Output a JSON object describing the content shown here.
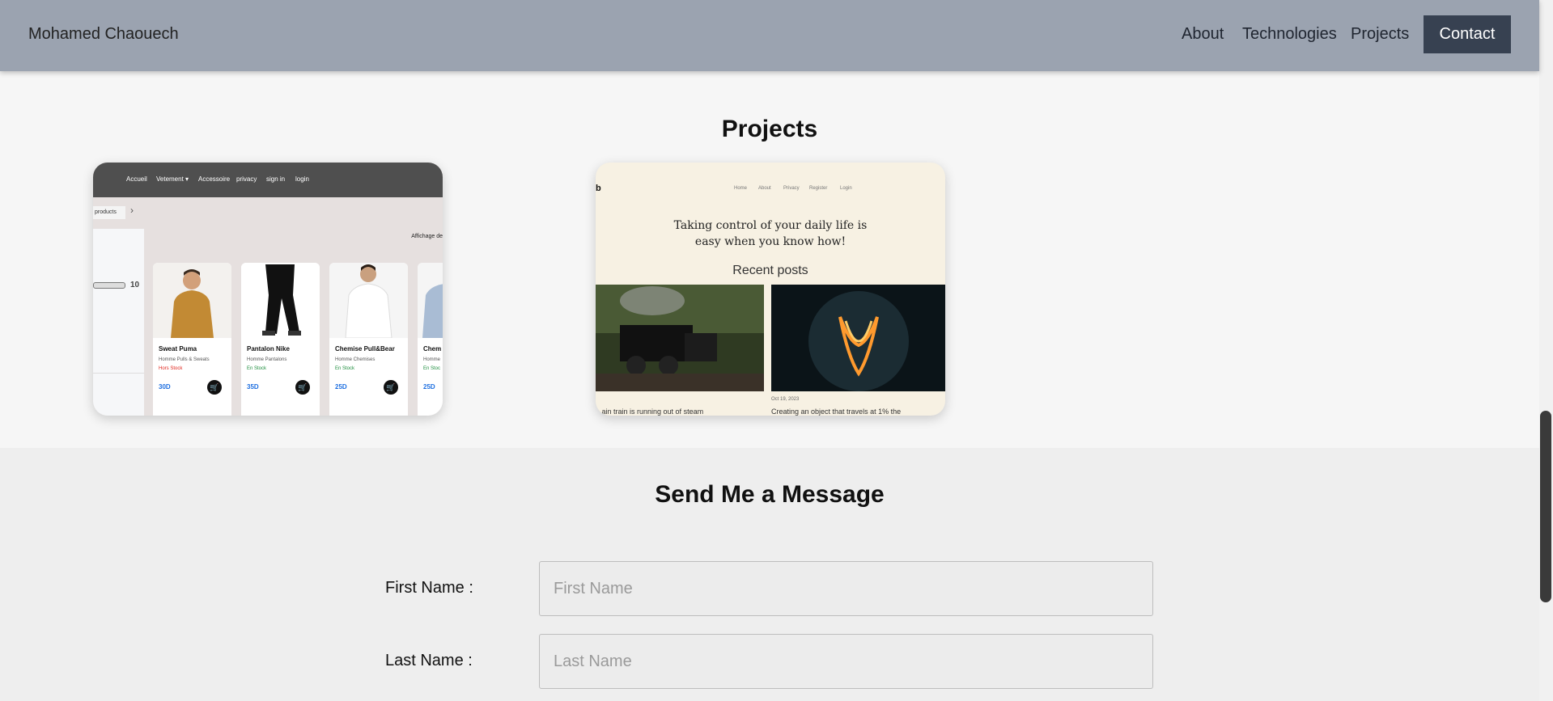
{
  "header": {
    "brand": "Mohamed Chaouech",
    "nav": [
      "About",
      "Technologies",
      "Projects"
    ],
    "contact_label": "Contact",
    "bg_color": "#9ba3b0",
    "button_color": "#374151"
  },
  "projects": {
    "title": "Projects",
    "shop_card": {
      "nav": [
        "Accueil",
        "Vetement ▾",
        "Accessoire",
        "privacy",
        "sign in",
        "login"
      ],
      "breadcrumb": "products",
      "display_text": "Affichage de",
      "price_filter_value": "10",
      "products": [
        {
          "name": "Sweat Puma",
          "category": "Homme Pulls & Sweats",
          "stock": "Hors Stock",
          "price": "30D",
          "stock_color": "#e0241b",
          "image_icon": "sweater-photo"
        },
        {
          "name": "Pantalon Nike",
          "category": "Homme Pantalons",
          "stock": "En Stock",
          "price": "35D",
          "stock_color": "#1e8e3e",
          "image_icon": "pants-photo"
        },
        {
          "name": "Chemise Pull&Bear",
          "category": "Homme Chemises",
          "stock": "En Stock",
          "price": "25D",
          "stock_color": "#1e8e3e",
          "image_icon": "shirt-photo"
        },
        {
          "name": "Chem",
          "category": "Homme",
          "stock": "En Stoc",
          "price": "25D",
          "stock_color": "#1e8e3e",
          "image_icon": "shirt-photo"
        }
      ]
    },
    "blog_card": {
      "logo": "b",
      "nav": [
        "Home",
        "About",
        "Privacy",
        "Register",
        "Login"
      ],
      "tagline_1": "Taking control of your daily life is",
      "tagline_2": "easy when you know how!",
      "recent_label": "Recent posts",
      "posts": [
        {
          "date": "",
          "title": "...ain train is running out of steam",
          "image_icon": "steam-train-photo"
        },
        {
          "date": "Oct 19, 2023",
          "title": "Creating an object that travels at 1% the",
          "image_icon": "light-bulb-photo"
        }
      ]
    }
  },
  "message": {
    "title": "Send Me a Message",
    "first_name": {
      "label": "First Name :",
      "placeholder": "First Name"
    },
    "last_name": {
      "label": "Last Name :",
      "placeholder": "Last Name"
    }
  }
}
